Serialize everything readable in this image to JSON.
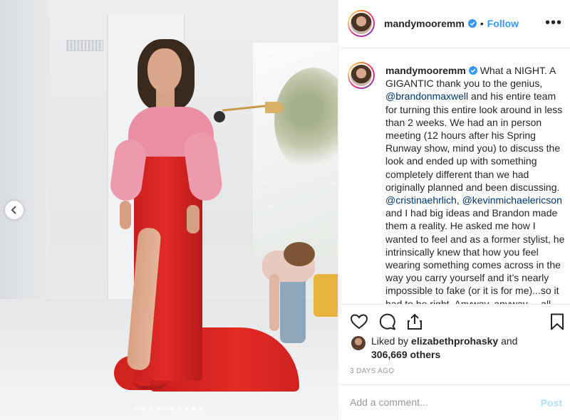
{
  "post": {
    "username": "mandymooremm",
    "follow_label": "Follow",
    "bullet": "•",
    "more_label": "•••",
    "caption_username": "mandymooremm",
    "caption_parts": [
      {
        "type": "text",
        "text": " What a NIGHT. A GIGANTIC thank you to the genius, "
      },
      {
        "type": "mention",
        "text": "@brandonmaxwell"
      },
      {
        "type": "text",
        "text": " and his entire team for turning this entire look around in less than 2 weeks. We had an in person meeting (12 hours after his Spring Runway show, mind you) to discuss the look and ended up with something completely different than we had originally planned and been discussing. "
      },
      {
        "type": "mention",
        "text": "@cristinaehrlich"
      },
      {
        "type": "text",
        "text": ", "
      },
      {
        "type": "mention",
        "text": "@kevinmichaelericson"
      },
      {
        "type": "text",
        "text": " and I had big ideas and Brandon made them a reality. He asked me how I wanted to feel and as a former stylist, he intrinsically knew that how you feel wearing something comes across in the way you carry yourself and it’s nearly impossible to fake (or it is for me)...so it had to be right. Anyway, anyway.... all"
      }
    ],
    "likes": {
      "prefix": "Liked by ",
      "user": "elizabethprohasky",
      "middle": " and",
      "count": "306,669 others"
    },
    "date": "3 DAYS AGO",
    "comment_placeholder": "Add a comment...",
    "post_label": "Post",
    "carousel": {
      "total": 10,
      "active": 9
    }
  },
  "icons": {
    "verified": "verified-badge-icon",
    "more": "more-options-icon",
    "like": "heart-icon",
    "comment": "comment-icon",
    "share": "share-icon",
    "save": "bookmark-icon",
    "prev": "chevron-left-icon"
  },
  "colors": {
    "link": "#3897f0",
    "mention": "#003569",
    "post_disabled": "#b2dffc",
    "muted": "#999999"
  }
}
